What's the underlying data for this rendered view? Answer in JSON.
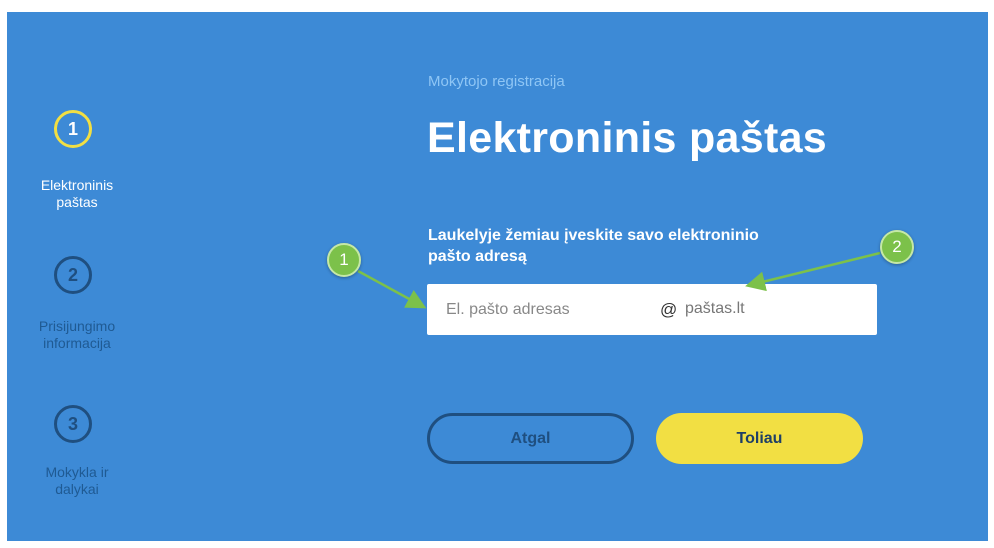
{
  "stepper": {
    "steps": [
      {
        "number": "1",
        "label_line1": "Elektroninis",
        "label_line2": "paštas",
        "state": "active"
      },
      {
        "number": "2",
        "label_line1": "Prisijungimo",
        "label_line2": "informacija",
        "state": "inactive"
      },
      {
        "number": "3",
        "label_line1": "Mokykla ir",
        "label_line2": "dalykai",
        "state": "inactive"
      }
    ]
  },
  "header": {
    "subtitle": "Mokytojo registracija",
    "title": "Elektroninis paštas"
  },
  "form": {
    "instruction_line1": "Laukelyje žemiau įveskite savo elektroninio",
    "instruction_line2": "pašto adresą",
    "email_placeholder": "El. pašto adresas",
    "at_sign": "@",
    "domain": "paštas.lt"
  },
  "buttons": {
    "back_label": "Atgal",
    "next_label": "Toliau"
  },
  "annotations": {
    "marker1": "1",
    "marker2": "2"
  },
  "colors": {
    "background": "#3d8ad6",
    "accent_yellow": "#f2df43",
    "dark_blue": "#1f4f80",
    "marker_green": "#7cc14a"
  }
}
